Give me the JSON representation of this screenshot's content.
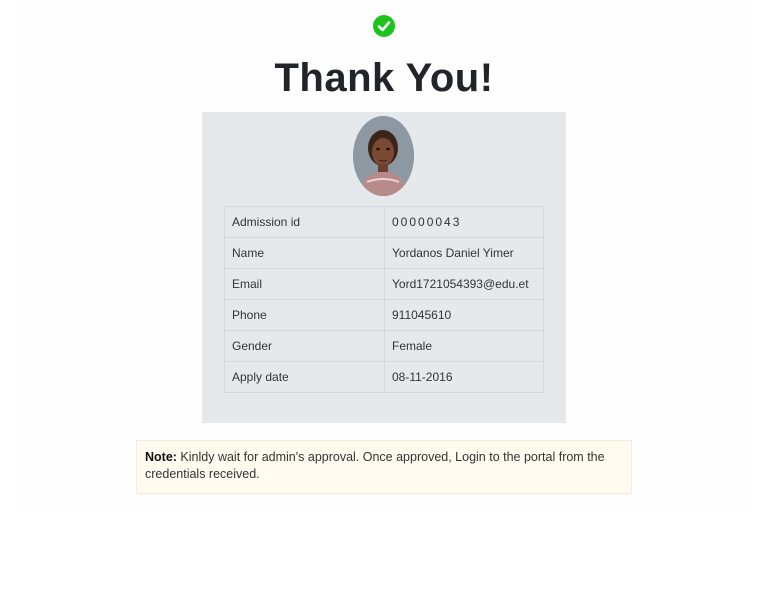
{
  "header": {
    "icon": "check-circle-icon",
    "title": "Thank You!"
  },
  "profile": {
    "photo": "student-portrait-photo",
    "rows": [
      {
        "label": "Admission id",
        "value": "00000043"
      },
      {
        "label": "Name",
        "value": "Yordanos Daniel Yimer"
      },
      {
        "label": "Email",
        "value": "Yord1721054393@edu.et"
      },
      {
        "label": "Phone",
        "value": "911045610"
      },
      {
        "label": "Gender",
        "value": "Female"
      },
      {
        "label": "Apply date",
        "value": "08-11-2016"
      }
    ]
  },
  "note": {
    "label": "Note:",
    "text": " Kinldy wait for admin's approval. Once approved, Login to the portal from the credentials received."
  },
  "colors": {
    "success": "#1ec31e",
    "card_bg": "#e6e9ec",
    "note_bg": "#fffbf0"
  }
}
